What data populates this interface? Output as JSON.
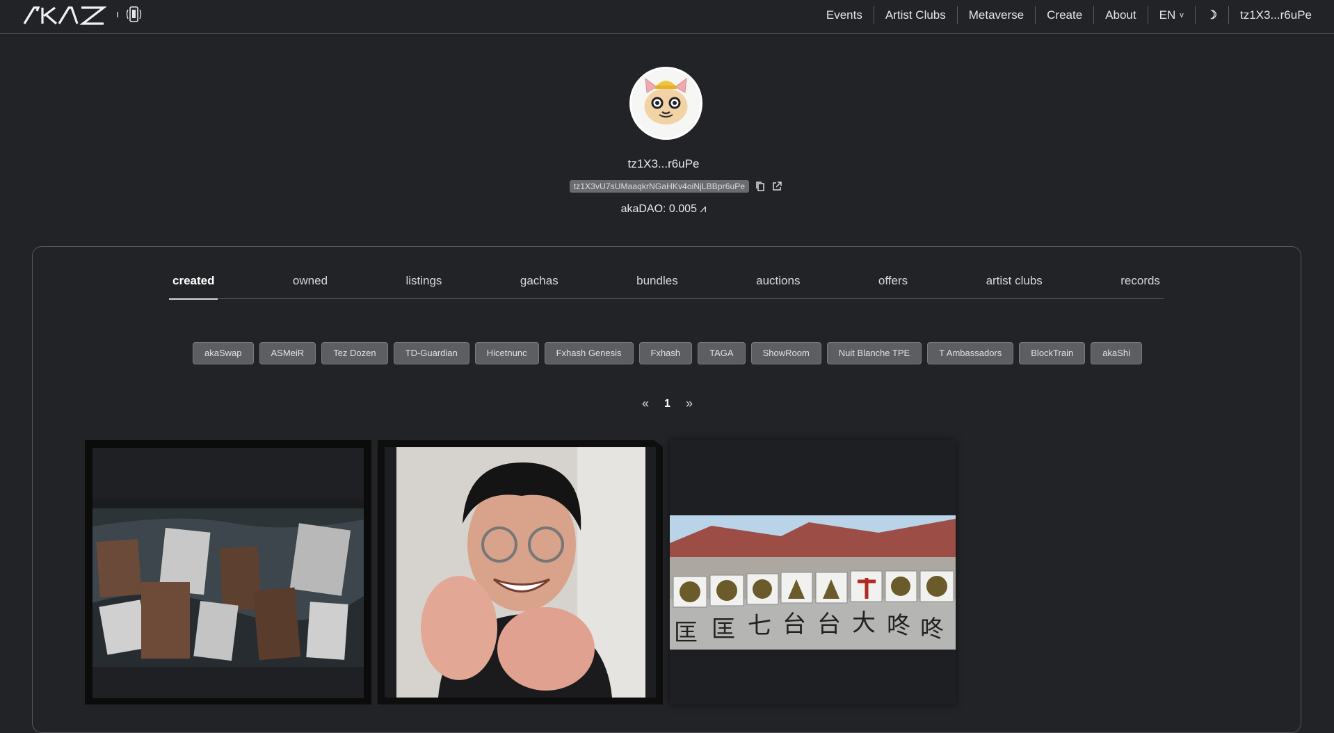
{
  "header": {
    "logo_icon": "akaswap-logo",
    "device_icon": "phone-device-icon",
    "nav": [
      {
        "label": "Events"
      },
      {
        "label": "Artist Clubs"
      },
      {
        "label": "Metaverse"
      },
      {
        "label": "Create"
      },
      {
        "label": "About"
      },
      {
        "label": "EN",
        "icon": "chevron-down-icon"
      },
      {
        "label": "☽",
        "icon": "moon-icon"
      },
      {
        "label": "tz1X3...r6uPe"
      }
    ]
  },
  "profile": {
    "avatar_icon": "cat-avatar",
    "name": "tz1X3...r6uPe",
    "address": "tz1X3vU7sUMaaqkrNGaHKv4oiNjLBBpr6uPe",
    "dao_balance": "akaDAO: 0.005 ⩘"
  },
  "tabs": [
    {
      "label": "created",
      "active": true
    },
    {
      "label": "owned"
    },
    {
      "label": "listings"
    },
    {
      "label": "gachas"
    },
    {
      "label": "bundles"
    },
    {
      "label": "auctions"
    },
    {
      "label": "offers"
    },
    {
      "label": "artist clubs"
    },
    {
      "label": "records"
    }
  ],
  "filters": [
    "akaSwap",
    "ASMeiR",
    "Tez Dozen",
    "TD-Guardian",
    "Hicetnunc",
    "Fxhash Genesis",
    "Fxhash",
    "TAGA",
    "ShowRoom",
    "Nuit Blanche TPE",
    "T Ambassadors",
    "BlockTrain",
    "akaShi"
  ],
  "pagination": {
    "prev": "«",
    "current": "1",
    "next": "»"
  },
  "cards": [
    {
      "image": "virtual-gallery-screenshot"
    },
    {
      "image": "person-portrait"
    },
    {
      "image": "temple-objects-panorama"
    }
  ],
  "colors": {
    "background": "#222326",
    "chip_bg": "#5d5e62",
    "border": "#55565a"
  }
}
